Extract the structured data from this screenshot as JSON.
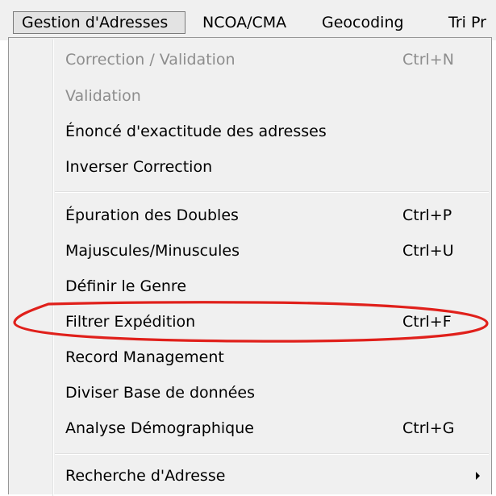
{
  "menubar": {
    "items": [
      {
        "label": "Gestion d'Adresses"
      },
      {
        "label": "NCOA/CMA"
      },
      {
        "label": "Geocoding"
      },
      {
        "label": "Tri Pr"
      }
    ]
  },
  "menu": {
    "items": [
      {
        "label": "Correction / Validation",
        "shortcut": "Ctrl+N",
        "enabled": false
      },
      {
        "label": "Validation",
        "shortcut": "",
        "enabled": false
      },
      {
        "label": "Énoncé d'exactitude des adresses",
        "shortcut": "",
        "enabled": true
      },
      {
        "label": "Inverser Correction",
        "shortcut": "",
        "enabled": true
      },
      {
        "label": "Épuration des Doubles",
        "shortcut": "Ctrl+P",
        "enabled": true
      },
      {
        "label": "Majuscules/Minuscules",
        "shortcut": "Ctrl+U",
        "enabled": true
      },
      {
        "label": "Définir le Genre",
        "shortcut": "",
        "enabled": true
      },
      {
        "label": "Filtrer Expédition",
        "shortcut": "Ctrl+F",
        "enabled": true,
        "highlighted": true
      },
      {
        "label": "Record Management",
        "shortcut": "",
        "enabled": true
      },
      {
        "label": "Diviser Base de données",
        "shortcut": "",
        "enabled": true
      },
      {
        "label": "Analyse Démographique",
        "shortcut": "Ctrl+G",
        "enabled": true
      },
      {
        "label": "Recherche d'Adresse",
        "shortcut": "",
        "enabled": true,
        "submenu": true
      }
    ]
  },
  "colors": {
    "menu_bg": "#f0f0f0",
    "disabled_text": "#8d8d8d",
    "annotation": "#e0201b"
  }
}
